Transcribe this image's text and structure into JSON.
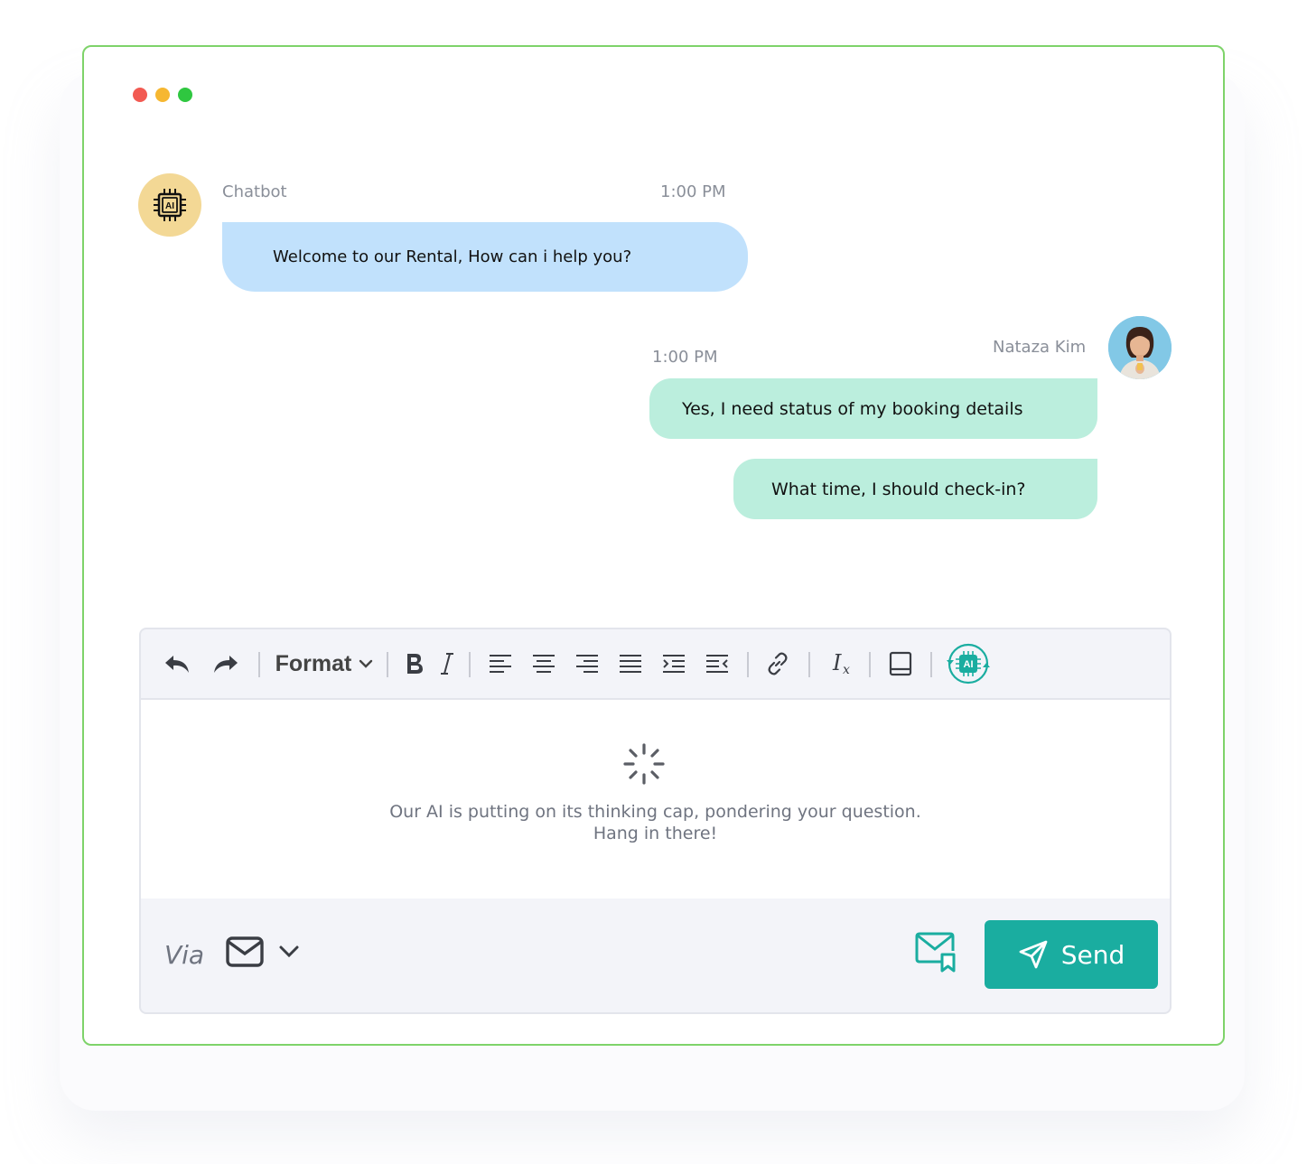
{
  "colors": {
    "window_border": "#7ed36a",
    "bot_bubble": "#c1e1fc",
    "user_bubble": "#bbeedd",
    "accent": "#1aada0",
    "dot_red": "#f25a52",
    "dot_yellow": "#f6b731",
    "dot_green": "#2fc740"
  },
  "bot": {
    "name": "Chatbot",
    "time": "1:00 PM",
    "message": "Welcome to our Rental, How can i help you?",
    "icon_text": "AI"
  },
  "user": {
    "name": "Nataza Kim",
    "time": "1:00 PM",
    "messages": [
      "Yes, I need status of my booking details",
      "What time, I should check-in?"
    ]
  },
  "toolbar": {
    "format_label": "Format",
    "ai_label": "AI",
    "icons": [
      "undo-icon",
      "redo-icon",
      "bold-icon",
      "italic-icon",
      "align-left-icon",
      "align-center-icon",
      "align-right-icon",
      "align-justify-icon",
      "indent-icon",
      "outdent-icon",
      "link-icon",
      "clear-format-icon",
      "book-icon",
      "ai-assist-icon"
    ]
  },
  "editor": {
    "thinking_line1": "Our AI is putting on its thinking cap, pondering your question.",
    "thinking_line2": "Hang in there!"
  },
  "footer": {
    "via_label": "Via",
    "channel_icon": "mail-icon",
    "send_label": "Send"
  }
}
